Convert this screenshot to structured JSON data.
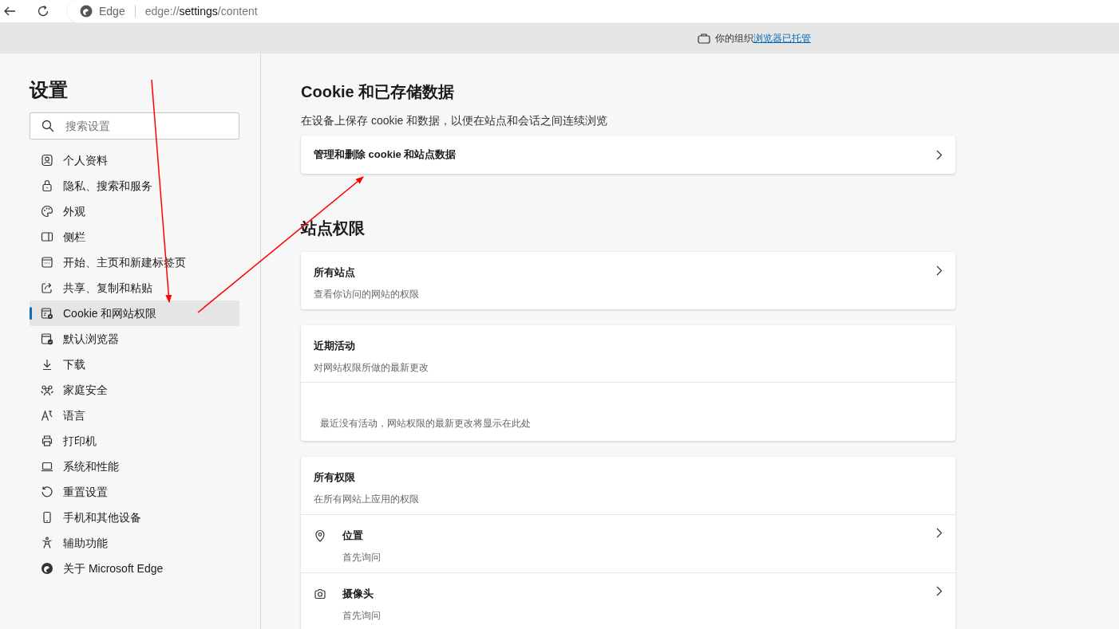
{
  "browser": {
    "brand": "Edge",
    "url": {
      "prefix": "edge://",
      "highlight": "settings",
      "suffix": "/content"
    }
  },
  "managed_notice": {
    "text": "你的组织",
    "link": "浏览器已托管"
  },
  "sidebar": {
    "title": "设置",
    "search": {
      "placeholder": "搜索设置"
    },
    "items": [
      {
        "label": "个人资料",
        "selected": false
      },
      {
        "label": "隐私、搜索和服务",
        "selected": false
      },
      {
        "label": "外观",
        "selected": false
      },
      {
        "label": "侧栏",
        "selected": false
      },
      {
        "label": "开始、主页和新建标签页",
        "selected": false
      },
      {
        "label": "共享、复制和粘贴",
        "selected": false
      },
      {
        "label": "Cookie 和网站权限",
        "selected": true
      },
      {
        "label": "默认浏览器",
        "selected": false
      },
      {
        "label": "下载",
        "selected": false
      },
      {
        "label": "家庭安全",
        "selected": false
      },
      {
        "label": "语言",
        "selected": false
      },
      {
        "label": "打印机",
        "selected": false
      },
      {
        "label": "系统和性能",
        "selected": false
      },
      {
        "label": "重置设置",
        "selected": false
      },
      {
        "label": "手机和其他设备",
        "selected": false
      },
      {
        "label": "辅助功能",
        "selected": false
      },
      {
        "label": "关于 Microsoft Edge",
        "selected": false
      }
    ]
  },
  "main": {
    "cookie_section": {
      "heading": "Cookie 和已存储数据",
      "description": "在设备上保存 cookie 和数据，以便在站点和会话之间连续浏览",
      "link_row": "管理和删除 cookie 和站点数据"
    },
    "permissions_section": {
      "heading": "站点权限",
      "all_sites": {
        "title": "所有站点",
        "description": "查看你访问的网站的权限"
      },
      "recent_activity": {
        "title": "近期活动",
        "description": "对网站权限所做的最新更改",
        "empty_text": "最近没有活动，网站权限的最新更改将显示在此处"
      },
      "all_permissions": {
        "title": "所有权限",
        "description": "在所有网站上应用的权限",
        "items": [
          {
            "label": "位置",
            "status": "首先询问"
          },
          {
            "label": "摄像头",
            "status": "首先询问"
          }
        ]
      }
    }
  }
}
